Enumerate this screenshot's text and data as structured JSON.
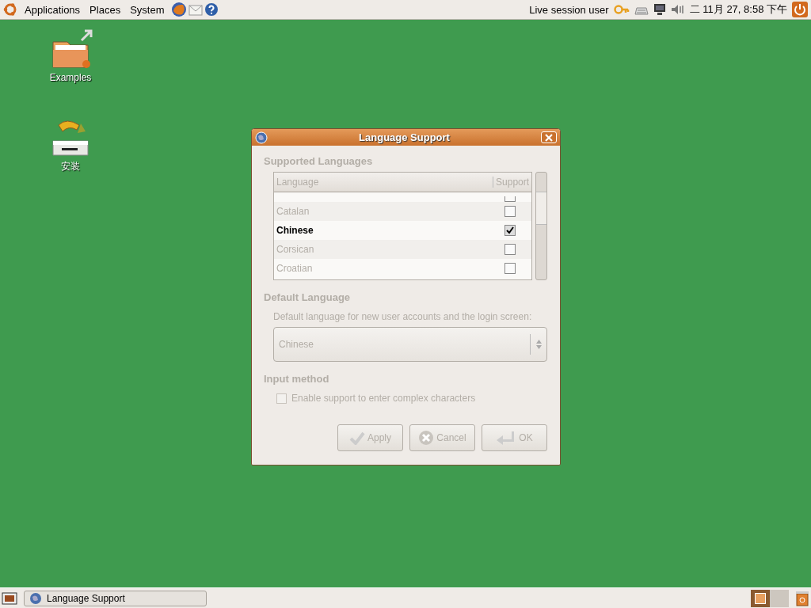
{
  "top_panel": {
    "menus": [
      "Applications",
      "Places",
      "System"
    ],
    "user": "Live session user",
    "clock": "二 11月 27, 8:58 下午"
  },
  "desktop_icons": [
    {
      "label": "Examples",
      "kind": "folder"
    },
    {
      "label": "安装",
      "kind": "installer"
    }
  ],
  "dialog": {
    "title": "Language Support",
    "supported_heading": "Supported Languages",
    "columns": [
      "Language",
      "Support"
    ],
    "partial_row": {
      "checked": false
    },
    "languages": [
      {
        "name": "Catalan",
        "checked": false,
        "current": false
      },
      {
        "name": "Chinese",
        "checked": true,
        "current": true
      },
      {
        "name": "Corsican",
        "checked": false,
        "current": false
      },
      {
        "name": "Croatian",
        "checked": false,
        "current": false
      }
    ],
    "default_heading": "Default Language",
    "default_caption": "Default language for new user accounts and the login screen:",
    "default_value": "Chinese",
    "input_heading": "Input method",
    "complex_option": {
      "label": "Enable support to enter complex characters",
      "checked": false
    },
    "buttons": [
      {
        "label": "Apply",
        "kind": "apply",
        "disabled": true
      },
      {
        "label": "Cancel",
        "kind": "cancel",
        "disabled": true
      },
      {
        "label": "OK",
        "kind": "ok",
        "disabled": true
      }
    ]
  },
  "taskbar": {
    "windows": [
      {
        "label": "Language Support",
        "selected": false
      }
    ]
  }
}
